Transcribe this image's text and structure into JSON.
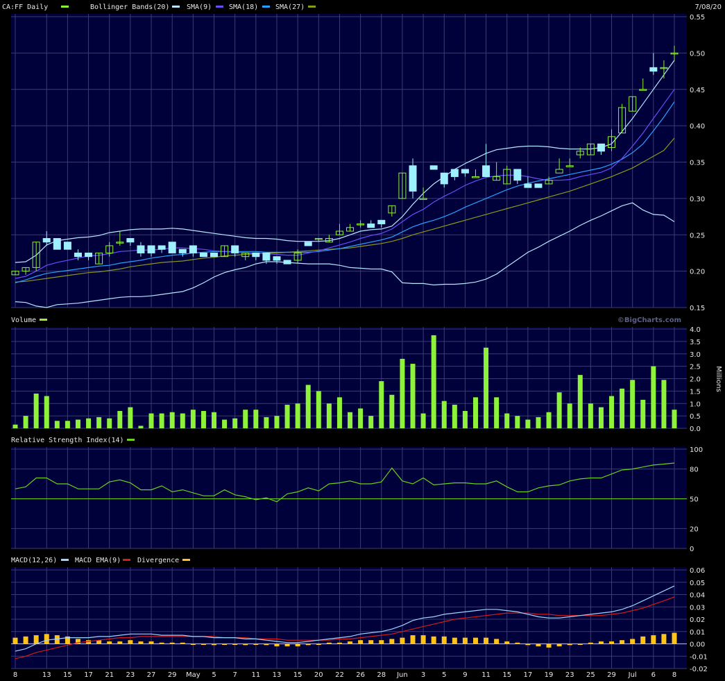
{
  "header": {
    "symbol_label": "CA:FF Daily",
    "bollinger_label": "Bollinger Bands(20)",
    "sma9_label": "SMA(9)",
    "sma18_label": "SMA(18)",
    "sma27_label": "SMA(27)",
    "date": "7/08/20"
  },
  "volume_panel": {
    "label": "Volume",
    "unit": "Millions",
    "watermark": "©BigCharts.com"
  },
  "rsi_panel": {
    "label": "Relative Strength Index(14)"
  },
  "macd_panel": {
    "label_macd": "MACD(12,26)",
    "label_ema": "MACD EMA(9)",
    "label_div": "Divergence"
  },
  "colors": {
    "background": "#000000",
    "panel": "#00003a",
    "grid": "#3b3d72",
    "up": "#8ef23b",
    "down": "#9ff0ff",
    "bollinger": "#b8e8ff",
    "sma9": "#6b4dff",
    "sma18": "#2aa0ff",
    "sma27": "#8a9a1a",
    "rsi": "#6ad21a",
    "macd": "#9fd6ff",
    "macd_ema": "#d81a1a",
    "divergence": "#ffc31a"
  },
  "chart_data": [
    {
      "type": "candlestick",
      "title": "CA:FF Daily",
      "date_label": "7/08/20",
      "x_tick_labels": [
        "8",
        "13",
        "15",
        "17",
        "21",
        "23",
        "27",
        "29",
        "May",
        "5",
        "7",
        "11",
        "13",
        "15",
        "20",
        "22",
        "26",
        "28",
        "Jun",
        "3",
        "5",
        "9",
        "11",
        "15",
        "17",
        "19",
        "23",
        "25",
        "29",
        "Jul",
        "6",
        "8"
      ],
      "y_ticks": [
        0.15,
        0.2,
        0.25,
        0.3,
        0.35,
        0.4,
        0.45,
        0.5,
        0.55
      ],
      "ylim": [
        0.15,
        0.55
      ],
      "ohlc": [
        [
          0.195,
          0.2,
          0.195,
          0.2
        ],
        [
          0.2,
          0.205,
          0.195,
          0.205
        ],
        [
          0.205,
          0.24,
          0.2,
          0.24
        ],
        [
          0.245,
          0.255,
          0.235,
          0.24
        ],
        [
          0.245,
          0.245,
          0.23,
          0.23
        ],
        [
          0.24,
          0.24,
          0.23,
          0.23
        ],
        [
          0.225,
          0.23,
          0.215,
          0.22
        ],
        [
          0.225,
          0.225,
          0.215,
          0.22
        ],
        [
          0.21,
          0.225,
          0.21,
          0.225
        ],
        [
          0.225,
          0.24,
          0.22,
          0.235
        ],
        [
          0.24,
          0.255,
          0.235,
          0.24
        ],
        [
          0.245,
          0.245,
          0.235,
          0.24
        ],
        [
          0.235,
          0.24,
          0.22,
          0.225
        ],
        [
          0.235,
          0.235,
          0.22,
          0.225
        ],
        [
          0.235,
          0.235,
          0.225,
          0.23
        ],
        [
          0.24,
          0.24,
          0.225,
          0.225
        ],
        [
          0.23,
          0.23,
          0.22,
          0.225
        ],
        [
          0.235,
          0.235,
          0.22,
          0.225
        ],
        [
          0.225,
          0.225,
          0.22,
          0.22
        ],
        [
          0.225,
          0.225,
          0.22,
          0.22
        ],
        [
          0.22,
          0.235,
          0.22,
          0.235
        ],
        [
          0.235,
          0.235,
          0.22,
          0.225
        ],
        [
          0.22,
          0.225,
          0.215,
          0.225
        ],
        [
          0.225,
          0.225,
          0.215,
          0.22
        ],
        [
          0.225,
          0.225,
          0.21,
          0.215
        ],
        [
          0.22,
          0.22,
          0.21,
          0.215
        ],
        [
          0.215,
          0.215,
          0.21,
          0.21
        ],
        [
          0.215,
          0.23,
          0.21,
          0.225
        ],
        [
          0.24,
          0.24,
          0.235,
          0.235
        ],
        [
          0.245,
          0.245,
          0.24,
          0.245
        ],
        [
          0.24,
          0.25,
          0.24,
          0.245
        ],
        [
          0.25,
          0.265,
          0.25,
          0.255
        ],
        [
          0.255,
          0.265,
          0.255,
          0.26
        ],
        [
          0.265,
          0.27,
          0.26,
          0.265
        ],
        [
          0.265,
          0.27,
          0.26,
          0.26
        ],
        [
          0.27,
          0.27,
          0.26,
          0.265
        ],
        [
          0.28,
          0.29,
          0.275,
          0.29
        ],
        [
          0.3,
          0.335,
          0.3,
          0.335
        ],
        [
          0.345,
          0.355,
          0.3,
          0.31
        ],
        [
          0.3,
          0.315,
          0.3,
          0.3
        ],
        [
          0.345,
          0.345,
          0.34,
          0.34
        ],
        [
          0.335,
          0.335,
          0.315,
          0.32
        ],
        [
          0.34,
          0.34,
          0.325,
          0.33
        ],
        [
          0.34,
          0.34,
          0.33,
          0.335
        ],
        [
          0.33,
          0.34,
          0.33,
          0.33
        ],
        [
          0.345,
          0.375,
          0.33,
          0.33
        ],
        [
          0.325,
          0.35,
          0.325,
          0.33
        ],
        [
          0.32,
          0.345,
          0.32,
          0.34
        ],
        [
          0.34,
          0.34,
          0.32,
          0.325
        ],
        [
          0.32,
          0.33,
          0.315,
          0.315
        ],
        [
          0.32,
          0.32,
          0.315,
          0.315
        ],
        [
          0.32,
          0.33,
          0.32,
          0.325
        ],
        [
          0.335,
          0.355,
          0.34,
          0.34
        ],
        [
          0.345,
          0.355,
          0.345,
          0.345
        ],
        [
          0.36,
          0.37,
          0.355,
          0.365
        ],
        [
          0.36,
          0.375,
          0.36,
          0.375
        ],
        [
          0.375,
          0.375,
          0.36,
          0.365
        ],
        [
          0.37,
          0.395,
          0.365,
          0.385
        ],
        [
          0.39,
          0.43,
          0.39,
          0.425
        ],
        [
          0.42,
          0.44,
          0.42,
          0.44
        ],
        [
          0.45,
          0.465,
          0.45,
          0.45
        ],
        [
          0.48,
          0.5,
          0.47,
          0.475
        ],
        [
          0.48,
          0.49,
          0.465,
          0.48
        ],
        [
          0.5,
          0.51,
          0.49,
          0.5
        ]
      ],
      "bollinger_upper": [
        0.212,
        0.213,
        0.222,
        0.236,
        0.242,
        0.244,
        0.246,
        0.247,
        0.249,
        0.253,
        0.255,
        0.257,
        0.258,
        0.258,
        0.258,
        0.259,
        0.258,
        0.256,
        0.254,
        0.252,
        0.25,
        0.248,
        0.246,
        0.245,
        0.245,
        0.244,
        0.242,
        0.241,
        0.241,
        0.241,
        0.242,
        0.245,
        0.25,
        0.255,
        0.257,
        0.258,
        0.262,
        0.275,
        0.292,
        0.307,
        0.32,
        0.33,
        0.34,
        0.348,
        0.355,
        0.362,
        0.367,
        0.369,
        0.371,
        0.372,
        0.372,
        0.371,
        0.369,
        0.368,
        0.368,
        0.368,
        0.37,
        0.375,
        0.392,
        0.41,
        0.43,
        0.45,
        0.47,
        0.49
      ],
      "bollinger_lower": [
        0.158,
        0.157,
        0.152,
        0.15,
        0.154,
        0.155,
        0.156,
        0.158,
        0.16,
        0.162,
        0.164,
        0.165,
        0.165,
        0.166,
        0.168,
        0.17,
        0.172,
        0.177,
        0.184,
        0.192,
        0.198,
        0.202,
        0.205,
        0.21,
        0.213,
        0.213,
        0.212,
        0.211,
        0.21,
        0.21,
        0.21,
        0.208,
        0.205,
        0.204,
        0.203,
        0.203,
        0.199,
        0.184,
        0.183,
        0.183,
        0.181,
        0.182,
        0.182,
        0.183,
        0.185,
        0.189,
        0.196,
        0.206,
        0.216,
        0.226,
        0.233,
        0.241,
        0.248,
        0.255,
        0.263,
        0.27,
        0.276,
        0.283,
        0.29,
        0.294,
        0.284,
        0.278,
        0.277,
        0.268
      ],
      "sma9": [
        0.19,
        0.193,
        0.2,
        0.208,
        0.212,
        0.215,
        0.218,
        0.221,
        0.222,
        0.224,
        0.227,
        0.228,
        0.229,
        0.229,
        0.23,
        0.232,
        0.232,
        0.231,
        0.23,
        0.228,
        0.227,
        0.226,
        0.225,
        0.225,
        0.224,
        0.223,
        0.222,
        0.222,
        0.225,
        0.228,
        0.232,
        0.236,
        0.24,
        0.245,
        0.249,
        0.252,
        0.258,
        0.268,
        0.278,
        0.285,
        0.295,
        0.303,
        0.31,
        0.318,
        0.324,
        0.329,
        0.331,
        0.332,
        0.332,
        0.33,
        0.327,
        0.325,
        0.325,
        0.326,
        0.33,
        0.333,
        0.336,
        0.342,
        0.355,
        0.372,
        0.39,
        0.41,
        0.43,
        0.45
      ],
      "sma18": [
        0.184,
        0.188,
        0.193,
        0.197,
        0.199,
        0.201,
        0.203,
        0.205,
        0.207,
        0.208,
        0.211,
        0.213,
        0.215,
        0.218,
        0.22,
        0.222,
        0.223,
        0.225,
        0.226,
        0.227,
        0.227,
        0.227,
        0.227,
        0.227,
        0.226,
        0.226,
        0.226,
        0.226,
        0.226,
        0.227,
        0.229,
        0.231,
        0.234,
        0.237,
        0.24,
        0.243,
        0.247,
        0.254,
        0.261,
        0.266,
        0.27,
        0.275,
        0.281,
        0.288,
        0.294,
        0.3,
        0.306,
        0.312,
        0.317,
        0.321,
        0.324,
        0.327,
        0.33,
        0.333,
        0.336,
        0.339,
        0.342,
        0.347,
        0.354,
        0.363,
        0.375,
        0.393,
        0.412,
        0.433
      ],
      "sma27": [
        0.185,
        0.186,
        0.188,
        0.19,
        0.192,
        0.194,
        0.196,
        0.198,
        0.199,
        0.201,
        0.203,
        0.206,
        0.208,
        0.21,
        0.212,
        0.213,
        0.214,
        0.216,
        0.218,
        0.219,
        0.221,
        0.222,
        0.223,
        0.224,
        0.225,
        0.225,
        0.226,
        0.227,
        0.228,
        0.229,
        0.23,
        0.231,
        0.232,
        0.234,
        0.236,
        0.238,
        0.241,
        0.245,
        0.25,
        0.254,
        0.258,
        0.262,
        0.266,
        0.27,
        0.274,
        0.278,
        0.282,
        0.286,
        0.29,
        0.294,
        0.298,
        0.302,
        0.306,
        0.31,
        0.315,
        0.32,
        0.325,
        0.33,
        0.336,
        0.342,
        0.35,
        0.358,
        0.366,
        0.383
      ]
    },
    {
      "type": "bar",
      "title": "Volume",
      "ylabel": "Millions",
      "y_ticks": [
        0,
        0.5,
        1,
        1.5,
        2,
        2.5,
        3,
        3.5,
        4
      ],
      "ylim": [
        0,
        4
      ],
      "values": [
        0.15,
        0.5,
        1.4,
        1.3,
        0.3,
        0.3,
        0.35,
        0.4,
        0.45,
        0.4,
        0.7,
        0.85,
        0.1,
        0.6,
        0.6,
        0.65,
        0.6,
        0.75,
        0.7,
        0.65,
        0.35,
        0.4,
        0.75,
        0.75,
        0.45,
        0.5,
        0.95,
        1.0,
        1.75,
        1.5,
        1.0,
        1.25,
        0.65,
        0.8,
        0.5,
        1.9,
        1.35,
        2.8,
        2.6,
        0.6,
        3.75,
        1.1,
        0.95,
        0.7,
        1.25,
        3.25,
        1.25,
        0.6,
        0.5,
        0.35,
        0.45,
        0.65,
        1.45,
        1.0,
        2.15,
        1.0,
        0.85,
        1.3,
        1.6,
        1.95,
        1.15,
        2.5,
        1.95,
        0.75
      ]
    },
    {
      "type": "line",
      "title": "Relative Strength Index(14)",
      "y_ticks": [
        0,
        20,
        50,
        80,
        100
      ],
      "ylim": [
        0,
        100
      ],
      "reference_line": 50,
      "values": [
        60,
        62,
        71,
        71,
        65,
        65,
        60,
        60,
        60,
        67,
        69,
        66,
        59,
        59,
        63,
        57,
        59,
        56,
        53,
        53,
        59,
        54,
        52,
        49,
        51,
        47,
        55,
        57,
        61,
        58,
        65,
        66,
        68,
        65,
        65,
        67,
        81,
        68,
        65,
        71,
        64,
        65,
        66,
        66,
        65,
        65,
        68,
        62,
        57,
        57,
        61,
        63,
        64,
        68,
        70,
        71,
        71,
        75,
        79,
        80,
        82,
        84,
        85,
        86
      ]
    },
    {
      "type": "line",
      "title": "MACD(12,26)",
      "y_ticks": [
        -0.02,
        -0.01,
        0.0,
        0.01,
        0.02,
        0.03,
        0.04,
        0.05,
        0.06
      ],
      "ylim": [
        -0.02,
        0.06
      ],
      "series": [
        {
          "name": "MACD(12,26)",
          "values": [
            -0.006,
            -0.004,
            0.0,
            0.003,
            0.004,
            0.005,
            0.005,
            0.005,
            0.006,
            0.006,
            0.007,
            0.008,
            0.008,
            0.008,
            0.007,
            0.007,
            0.007,
            0.006,
            0.006,
            0.005,
            0.005,
            0.005,
            0.004,
            0.004,
            0.003,
            0.002,
            0.001,
            0.001,
            0.002,
            0.003,
            0.004,
            0.005,
            0.006,
            0.008,
            0.009,
            0.01,
            0.012,
            0.015,
            0.019,
            0.021,
            0.022,
            0.024,
            0.025,
            0.026,
            0.027,
            0.028,
            0.028,
            0.027,
            0.026,
            0.024,
            0.022,
            0.021,
            0.021,
            0.022,
            0.023,
            0.024,
            0.025,
            0.026,
            0.028,
            0.031,
            0.035,
            0.039,
            0.043,
            0.047
          ]
        },
        {
          "name": "MACD EMA(9)",
          "values": [
            -0.012,
            -0.01,
            -0.007,
            -0.005,
            -0.003,
            -0.001,
            0.001,
            0.002,
            0.003,
            0.004,
            0.005,
            0.005,
            0.006,
            0.006,
            0.006,
            0.006,
            0.006,
            0.006,
            0.006,
            0.006,
            0.005,
            0.005,
            0.005,
            0.004,
            0.004,
            0.004,
            0.003,
            0.003,
            0.003,
            0.003,
            0.003,
            0.004,
            0.004,
            0.005,
            0.006,
            0.007,
            0.008,
            0.01,
            0.012,
            0.014,
            0.016,
            0.018,
            0.02,
            0.021,
            0.022,
            0.023,
            0.024,
            0.025,
            0.025,
            0.025,
            0.024,
            0.024,
            0.023,
            0.023,
            0.023,
            0.023,
            0.023,
            0.024,
            0.025,
            0.027,
            0.029,
            0.032,
            0.035,
            0.038
          ]
        },
        {
          "name": "Divergence",
          "values": [
            0.005,
            0.006,
            0.007,
            0.008,
            0.007,
            0.006,
            0.004,
            0.003,
            0.003,
            0.002,
            0.002,
            0.003,
            0.002,
            0.002,
            0.001,
            0.001,
            0.001,
            0.0,
            0.0,
            -0.001,
            0.0,
            0.0,
            -0.001,
            0.0,
            -0.001,
            -0.002,
            -0.002,
            -0.002,
            -0.001,
            0.0,
            0.001,
            0.001,
            0.002,
            0.003,
            0.003,
            0.003,
            0.004,
            0.005,
            0.007,
            0.007,
            0.006,
            0.006,
            0.005,
            0.005,
            0.005,
            0.005,
            0.004,
            0.002,
            0.001,
            -0.001,
            -0.002,
            -0.003,
            -0.002,
            -0.001,
            0.0,
            0.001,
            0.002,
            0.002,
            0.003,
            0.004,
            0.006,
            0.007,
            0.008,
            0.009
          ]
        }
      ]
    }
  ]
}
